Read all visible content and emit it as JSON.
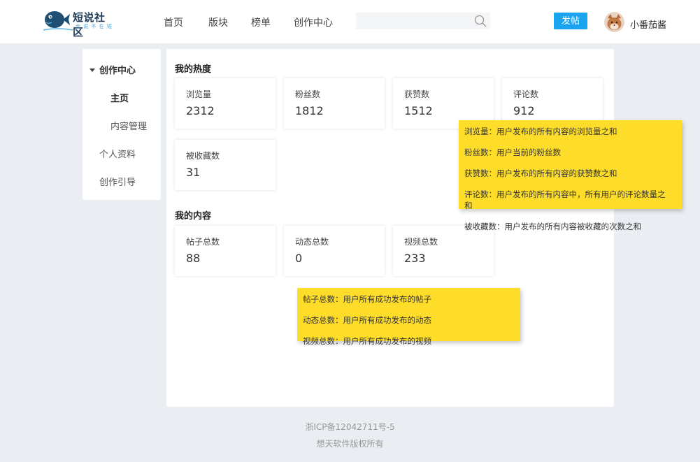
{
  "header": {
    "logo": {
      "title": "短说社区",
      "subtitle": "会 说 不 在 短"
    },
    "nav": [
      "首页",
      "版块",
      "榜单",
      "创作中心"
    ],
    "search": {
      "placeholder": "",
      "value": ""
    },
    "post_button": "发帖",
    "user_name": "小番茄酱",
    "accent_color": "#1aa3ee"
  },
  "sidebar": {
    "group_label": "创作中心",
    "sub_items": [
      "主页",
      "内容管理"
    ],
    "items": [
      "个人资料",
      "创作引导"
    ]
  },
  "heat": {
    "title": "我的热度",
    "cards": [
      {
        "label": "浏览量",
        "value": "2312"
      },
      {
        "label": "粉丝数",
        "value": "1812"
      },
      {
        "label": "获赞数",
        "value": "1512"
      },
      {
        "label": "评论数",
        "value": "912"
      },
      {
        "label": "被收藏数",
        "value": "31"
      }
    ]
  },
  "content": {
    "title": "我的内容",
    "cards": [
      {
        "label": "帖子总数",
        "value": "88"
      },
      {
        "label": "动态总数",
        "value": "0"
      },
      {
        "label": "视频总数",
        "value": "233"
      }
    ]
  },
  "notes": {
    "heat": [
      "浏览量：用户发布的所有内容的浏览量之和",
      "粉丝数：用户当前的粉丝数",
      "获赞数：用户发布的所有内容的获赞数之和",
      "评论数：用户发布的所有内容中，所有用户的评论数量之",
      "和",
      "被收藏数：用户发布的所有内容被收藏的次数之和"
    ],
    "content": [
      "帖子总数：用户所有成功发布的帖子",
      "动态总数：用户所有成功发布的动态",
      "视频总数：用户所有成功发布的视频"
    ],
    "color": "#fedd2a"
  },
  "footer": {
    "icp": "浙ICP备12042711号-5",
    "copyright": "想天软件版权所有"
  }
}
